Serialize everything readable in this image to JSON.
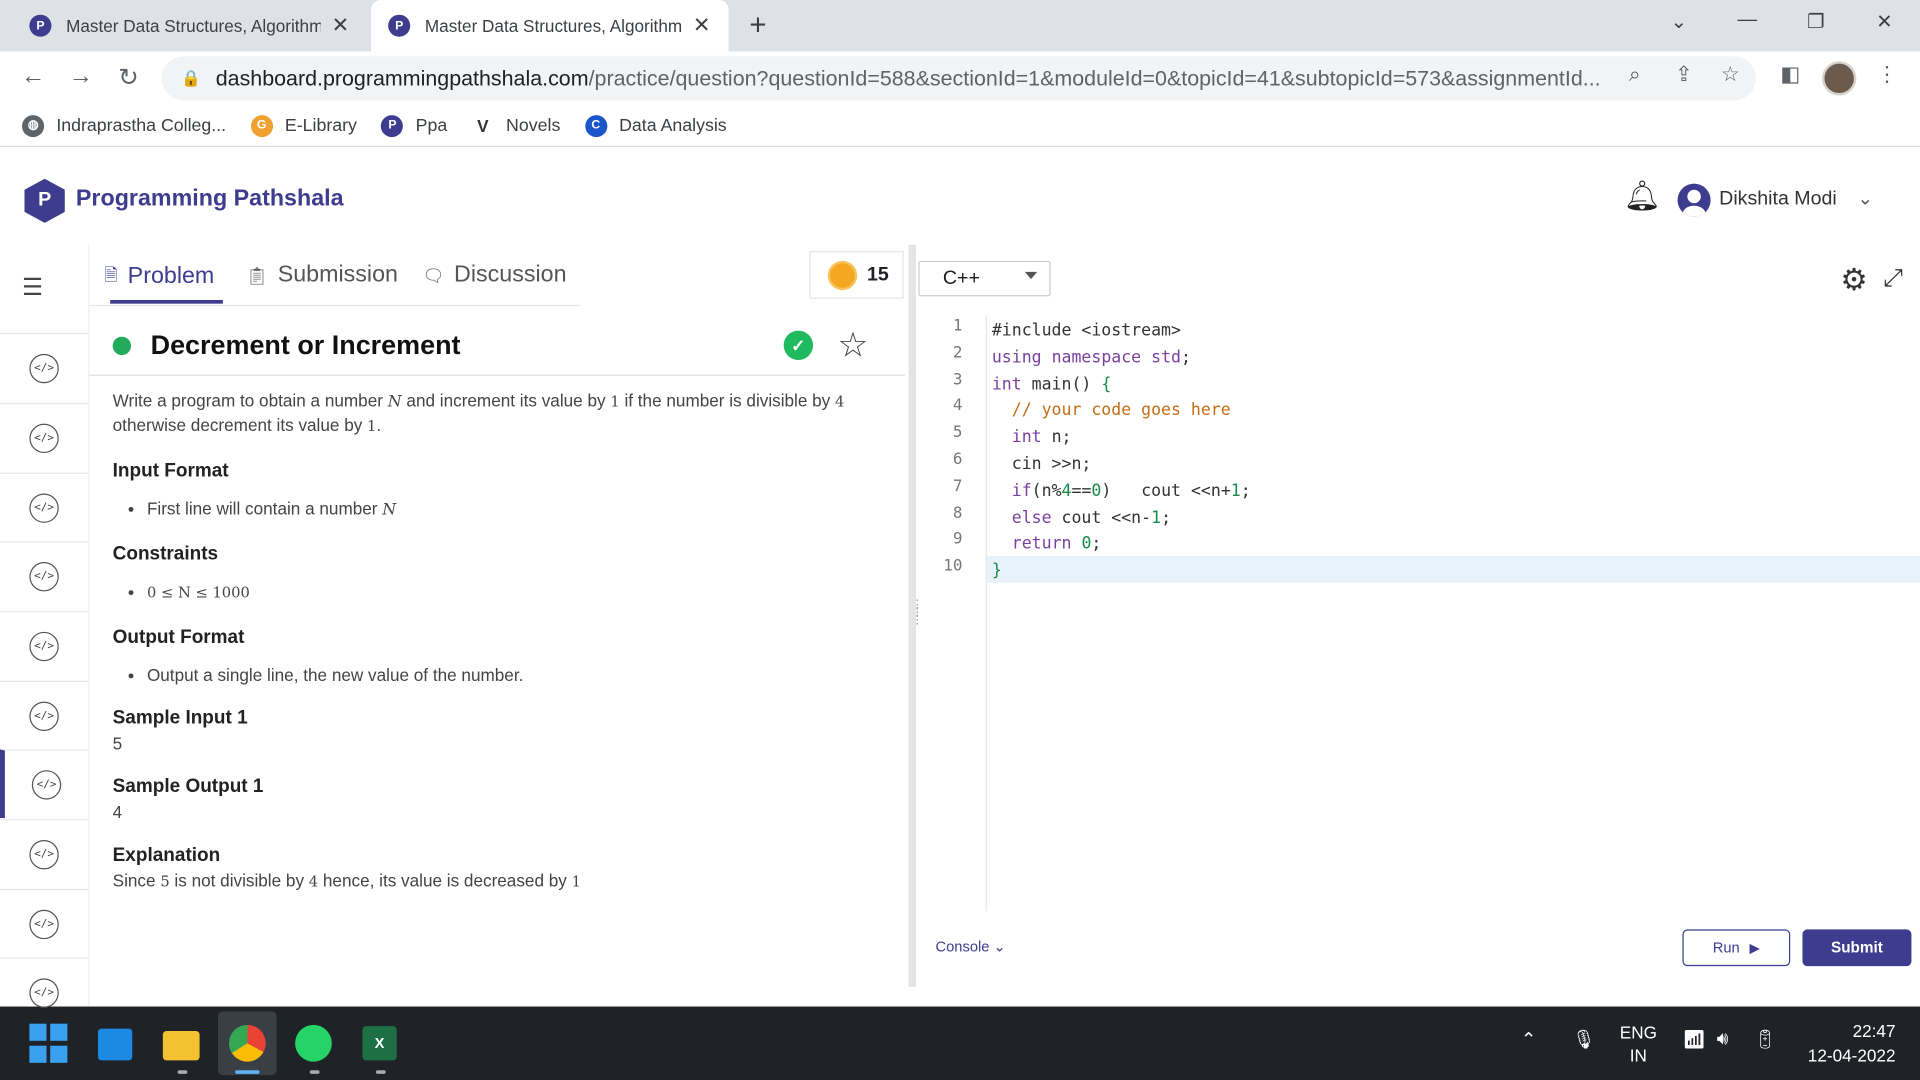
{
  "browser": {
    "tabs": [
      {
        "title": "Master Data Structures, Algorithms",
        "active": false
      },
      {
        "title": "Master Data Structures, Algorithms",
        "active": true
      }
    ],
    "url_host": "dashboard.programmingpathshala.com",
    "url_path": "/practice/question?questionId=588&sectionId=1&moduleId=0&topicId=41&subtopicId=573&assignmentId...",
    "bookmarks": [
      "Indraprastha Colleg...",
      "E-Library",
      "Ppa",
      "Novels",
      "Data Analysis"
    ]
  },
  "app": {
    "brand": "Programming Pathshala",
    "user_name": "Dikshita Modi"
  },
  "problem_tabs": {
    "problem": "Problem",
    "submission": "Submission",
    "discussion": "Discussion"
  },
  "coins": "15",
  "problem": {
    "title": "Decrement or Increment",
    "statement_a": "Write a program to obtain a number ",
    "statement_var": "N",
    "statement_b": " and increment its value by ",
    "statement_one": "1",
    "statement_c": " if the number is divisible by ",
    "statement_four": "4",
    "statement_d": " otherwise decrement its value by ",
    "statement_one2": "1",
    "statement_e": ".",
    "input_format_heading": "Input Format",
    "input_format_item": "First line will contain a number ",
    "input_format_var": "N",
    "constraints_heading": "Constraints",
    "constraint": "0 ≤ N ≤ 1000",
    "output_format_heading": "Output Format",
    "output_format_item": "Output a single line, the new value of the number.",
    "sample_input_heading": "Sample Input 1",
    "sample_input": "5",
    "sample_output_heading": "Sample Output 1",
    "sample_output": "4",
    "explanation_heading": "Explanation",
    "explanation_a": "Since ",
    "explanation_five": "5",
    "explanation_b": " is not divisible by ",
    "explanation_four": "4",
    "explanation_c": " hence, its value is decreased by ",
    "explanation_one": "1"
  },
  "editor": {
    "language": "C++",
    "line_numbers": [
      "1",
      "2",
      "3",
      "4",
      "5",
      "6",
      "7",
      "8",
      "9",
      "10"
    ],
    "lines": [
      "#include <iostream>",
      "using namespace std;",
      "int main() {",
      "  // your code goes here",
      "  int n;",
      "  cin >>n;",
      "  if(n%4==0)   cout <<n+1;",
      "  else cout <<n-1;",
      "  return 0;",
      "}"
    ],
    "console_label": "Console",
    "run_label": "Run",
    "submit_label": "Submit"
  },
  "taskbar": {
    "lang_line1": "ENG",
    "lang_line2": "IN",
    "time": "22:47",
    "date": "12-04-2022"
  }
}
